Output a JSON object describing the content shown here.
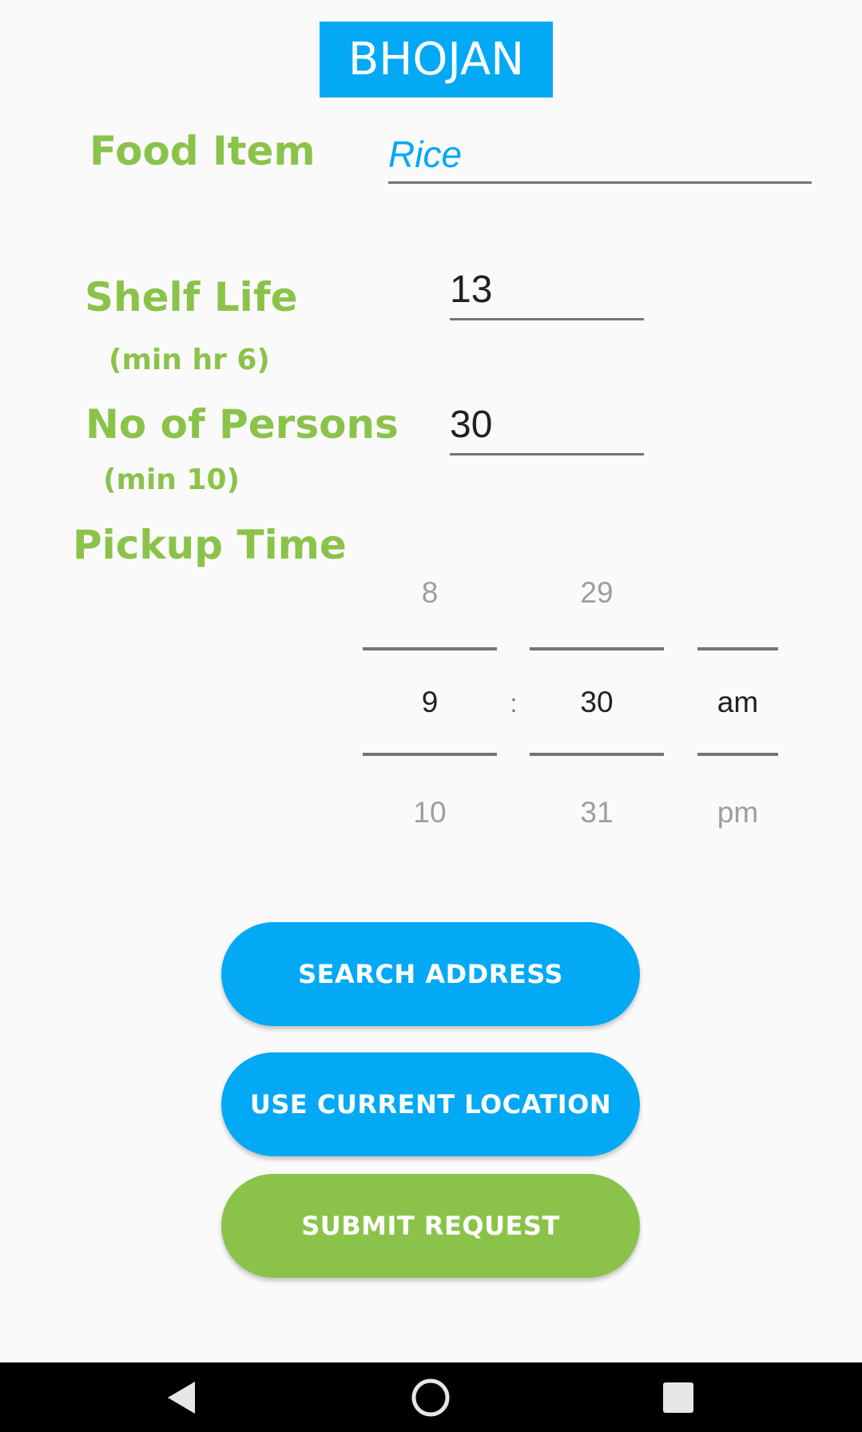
{
  "app": {
    "title": "BHOJAN"
  },
  "form": {
    "food_item": {
      "label": "Food Item",
      "value": "Rice"
    },
    "shelf_life": {
      "label": "Shelf Life",
      "hint": "(min hr 6)",
      "value": "13"
    },
    "persons": {
      "label": "No of Persons",
      "hint": "(min 10)",
      "value": "30"
    },
    "pickup_time": {
      "label": "Pickup Time",
      "separator": ":",
      "hour": {
        "prev": "8",
        "selected": "9",
        "next": "10"
      },
      "minute": {
        "prev": "29",
        "selected": "30",
        "next": "31"
      },
      "ampm": {
        "prev": "",
        "selected": "am",
        "next": "pm"
      }
    }
  },
  "buttons": {
    "search_address": "SEARCH ADDRESS",
    "use_current_location": "USE CURRENT LOCATION",
    "submit_request": "SUBMIT REQUEST"
  },
  "navbar": {
    "back": "back-icon",
    "home": "home-icon",
    "recents": "recents-icon"
  },
  "colors": {
    "accent_blue": "#03a9f4",
    "accent_green": "#8bc34a",
    "background": "#fafafa"
  }
}
